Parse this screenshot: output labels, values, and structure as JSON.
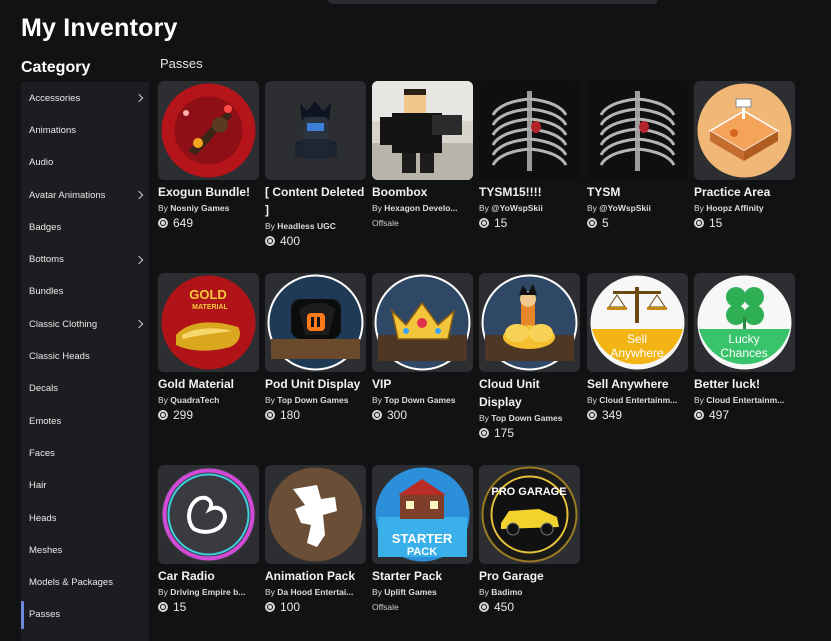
{
  "page": {
    "title": "My Inventory"
  },
  "sidebar": {
    "title": "Category",
    "items": [
      {
        "label": "Accessories",
        "chevron": true
      },
      {
        "label": "Animations",
        "chevron": false
      },
      {
        "label": "Audio",
        "chevron": false
      },
      {
        "label": "Avatar Animations",
        "chevron": true
      },
      {
        "label": "Badges",
        "chevron": false
      },
      {
        "label": "Bottoms",
        "chevron": true
      },
      {
        "label": "Bundles",
        "chevron": false
      },
      {
        "label": "Classic Clothing",
        "chevron": true
      },
      {
        "label": "Classic Heads",
        "chevron": false
      },
      {
        "label": "Decals",
        "chevron": false
      },
      {
        "label": "Emotes",
        "chevron": false
      },
      {
        "label": "Faces",
        "chevron": false
      },
      {
        "label": "Hair",
        "chevron": false
      },
      {
        "label": "Heads",
        "chevron": false
      },
      {
        "label": "Meshes",
        "chevron": false
      },
      {
        "label": "Models & Packages",
        "chevron": false
      },
      {
        "label": "Passes",
        "chevron": false,
        "active": true
      }
    ]
  },
  "main": {
    "section_title": "Passes",
    "items": [
      {
        "name": "Exogun Bundle!",
        "by": "By",
        "creator": "Nosniy Games",
        "price": "649",
        "thumb": "exogun"
      },
      {
        "name": "[ Content Deleted ]",
        "by": "By",
        "creator": "Headless UGC",
        "price": "400",
        "thumb": "deleted"
      },
      {
        "name": "Boombox",
        "by": "By",
        "creator": "Hexagon Develo...",
        "offsale": "Offsale",
        "thumb": "boombox"
      },
      {
        "name": "TYSM15!!!!",
        "by": "By",
        "creator": "@YoWspSkii",
        "price": "15",
        "thumb": "ribcage"
      },
      {
        "name": "TYSM",
        "by": "By",
        "creator": "@YoWspSkii",
        "price": "5",
        "thumb": "ribcage"
      },
      {
        "name": "Practice Area",
        "by": "By",
        "creator": "Hoopz Affinity",
        "price": "15",
        "thumb": "court"
      },
      {
        "name": "Gold Material",
        "by": "By",
        "creator": "QuadraTech",
        "price": "299",
        "thumb": "gold",
        "thumb_text": "GOLD MATERIAL"
      },
      {
        "name": "Pod Unit Display",
        "by": "By",
        "creator": "Top Down Games",
        "price": "180",
        "thumb": "pod"
      },
      {
        "name": "VIP",
        "by": "By",
        "creator": "Top Down Games",
        "price": "300",
        "thumb": "crown"
      },
      {
        "name": "Cloud Unit Display",
        "by": "By",
        "creator": "Top Down Games",
        "price": "175",
        "thumb": "cloud"
      },
      {
        "name": "Sell Anywhere",
        "by": "By",
        "creator": "Cloud Entertainm...",
        "price": "349",
        "thumb": "scale",
        "thumb_text": "Sell Anywhere"
      },
      {
        "name": "Better luck!",
        "by": "By",
        "creator": "Cloud Entertainm...",
        "price": "497",
        "thumb": "clover",
        "thumb_text": "Lucky Chances"
      },
      {
        "name": "Car Radio",
        "by": "By",
        "creator": "Driving Empire b...",
        "price": "15",
        "thumb": "radio"
      },
      {
        "name": "Animation Pack",
        "by": "By",
        "creator": "Da Hood Entertai...",
        "price": "100",
        "thumb": "anim"
      },
      {
        "name": "Starter Pack",
        "by": "By",
        "creator": "Uplift Games",
        "offsale": "Offsale",
        "thumb": "starter",
        "thumb_text": "STARTER PACK"
      },
      {
        "name": "Pro Garage",
        "by": "By",
        "creator": "Badimo",
        "price": "450",
        "thumb": "garage",
        "thumb_text": "PRO GARAGE"
      }
    ]
  }
}
